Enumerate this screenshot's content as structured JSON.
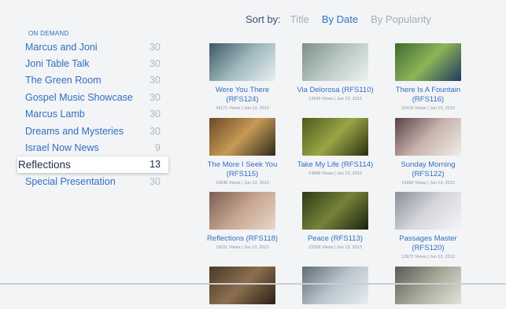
{
  "sort": {
    "label": "Sort by:",
    "options": [
      "Title",
      "By Date",
      "By Popularity"
    ],
    "active": "By Date"
  },
  "sidebar": {
    "section_label": "ON DEMAND",
    "items": [
      {
        "label": "Marcus and Joni",
        "count": "30"
      },
      {
        "label": "Joni Table Talk",
        "count": "30"
      },
      {
        "label": "The Green Room",
        "count": "30"
      },
      {
        "label": "Gospel Music Showcase",
        "count": "30"
      },
      {
        "label": "Marcus Lamb",
        "count": "30"
      },
      {
        "label": "Dreams and Mysteries",
        "count": "30"
      },
      {
        "label": "Israel Now News",
        "count": "9"
      },
      {
        "label": "Reflections",
        "count": "13",
        "selected": true
      },
      {
        "label": "Special Presentation",
        "count": "30"
      }
    ]
  },
  "videos": [
    {
      "title": "Were You There (RFS124)",
      "meta": "43171 Views | Jun 13, 2013",
      "colors": [
        "#3b5a63",
        "#9fb7bd",
        "#e8eef0"
      ]
    },
    {
      "title": "Via Delorosa (RFS110)",
      "meta": "12649 Views | Jun 13, 2013",
      "colors": [
        "#7d8f86",
        "#b9c9c6",
        "#eef2ef"
      ]
    },
    {
      "title": "There Is A Fountain (RFS116)",
      "meta": "20415 Views | Jun 13, 2013",
      "colors": [
        "#3e6b2e",
        "#8fb45a",
        "#1c3a5e"
      ]
    },
    {
      "title": "The More I Seek You (RFS115)",
      "meta": "23546 Views | Jun 13, 2013",
      "colors": [
        "#6b4a25",
        "#c69a56",
        "#2e2a1c"
      ]
    },
    {
      "title": "Take My Life (RFS114)",
      "meta": "14888 Views | Jun 13, 2013",
      "colors": [
        "#4e5a1e",
        "#9aa545",
        "#2a2e12"
      ]
    },
    {
      "title": "Sunday Morning (RFS122)",
      "meta": "16990 Views | Jun 13, 2013",
      "colors": [
        "#5a4048",
        "#c8b3ad",
        "#f0ece8"
      ]
    },
    {
      "title": "Reflections (RFS118)",
      "meta": "19011 Views | Jun 13, 2013",
      "colors": [
        "#7a5f52",
        "#c7a590",
        "#e6d8cc"
      ]
    },
    {
      "title": "Peace (RFS113)",
      "meta": "23308 Views | Jun 13, 2013",
      "colors": [
        "#2c3b14",
        "#77823b",
        "#1a2210"
      ]
    },
    {
      "title": "Passages Master (RFS120)",
      "meta": "13972 Views | Jun 13, 2013",
      "colors": [
        "#8b8f98",
        "#d6d7dc",
        "#f4f4f6"
      ]
    },
    {
      "title": "",
      "meta": "",
      "colors": [
        "#4a3a28",
        "#8c6f4f",
        "#2a2016"
      ]
    },
    {
      "title": "",
      "meta": "",
      "colors": [
        "#5f6d78",
        "#b8c4cc",
        "#e8eef2"
      ]
    },
    {
      "title": "",
      "meta": "",
      "colors": [
        "#5a5a52",
        "#a8a89a",
        "#e2e2dc"
      ]
    }
  ]
}
